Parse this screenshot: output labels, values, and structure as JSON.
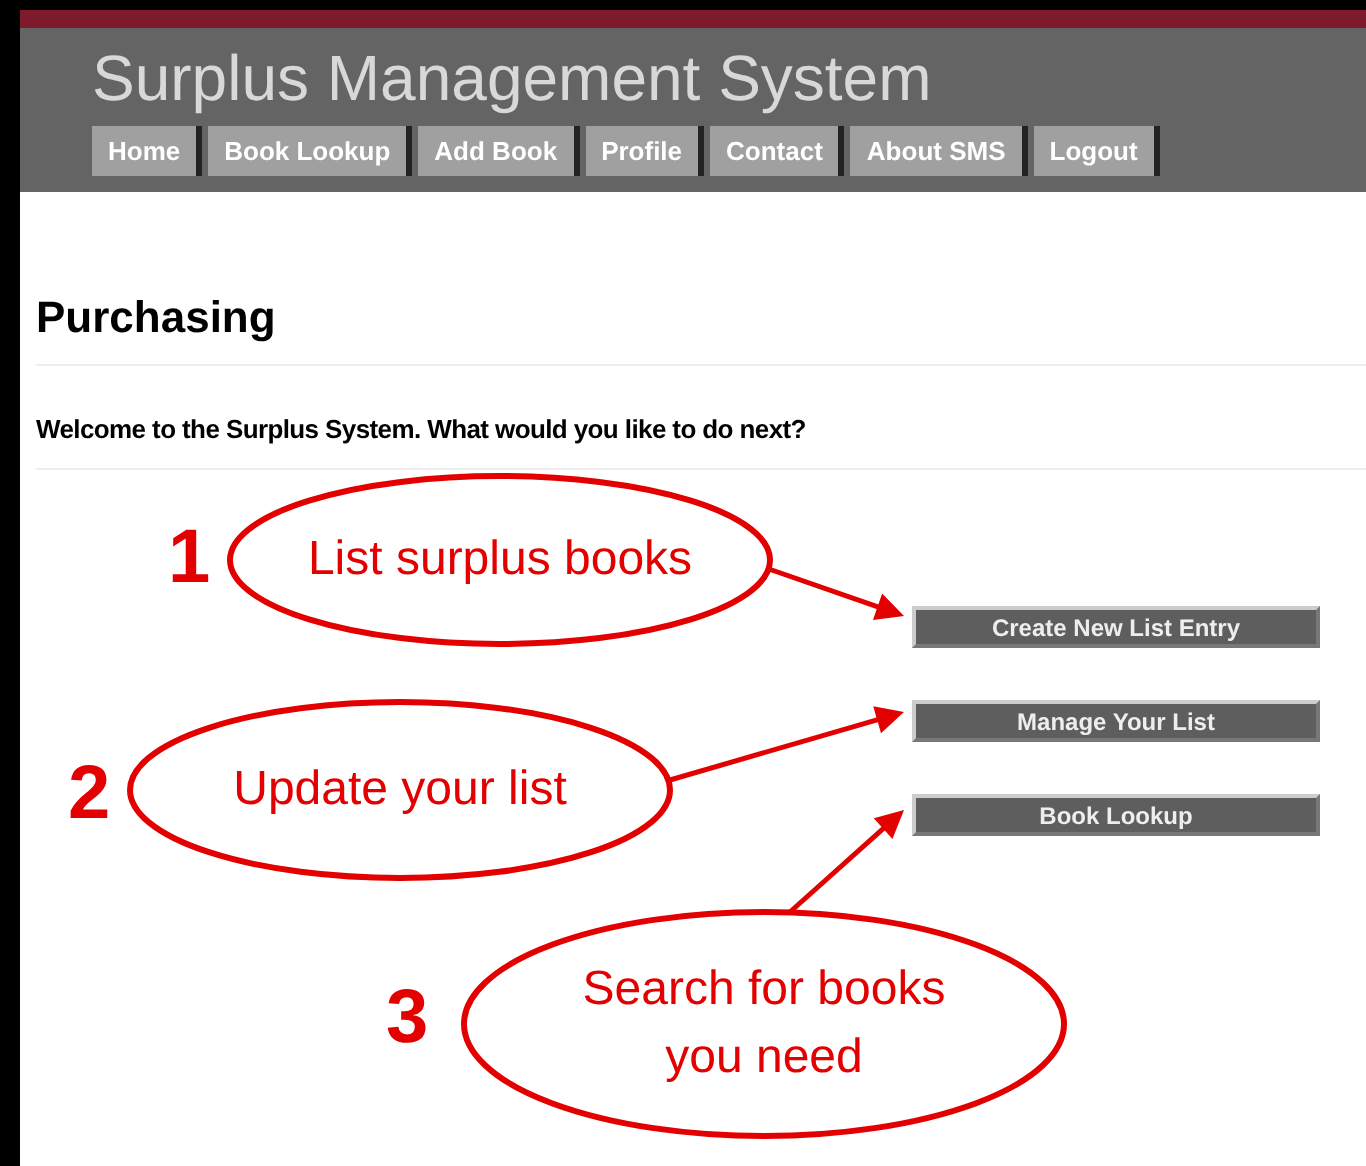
{
  "header": {
    "title": "Surplus Management System"
  },
  "nav": [
    {
      "label": "Home"
    },
    {
      "label": "Book Lookup"
    },
    {
      "label": "Add Book"
    },
    {
      "label": "Profile"
    },
    {
      "label": "Contact"
    },
    {
      "label": "About SMS"
    },
    {
      "label": "Logout"
    }
  ],
  "page": {
    "heading": "Purchasing",
    "welcome": "Welcome to the Surplus System. What would you like to do next?"
  },
  "actions": [
    "Create New List Entry",
    "Manage Your List",
    "Book Lookup"
  ],
  "annotations": [
    {
      "number": "1",
      "text": "List surplus books"
    },
    {
      "number": "2",
      "text": "Update your list"
    },
    {
      "number": "3",
      "text": "Search for books you need"
    }
  ]
}
